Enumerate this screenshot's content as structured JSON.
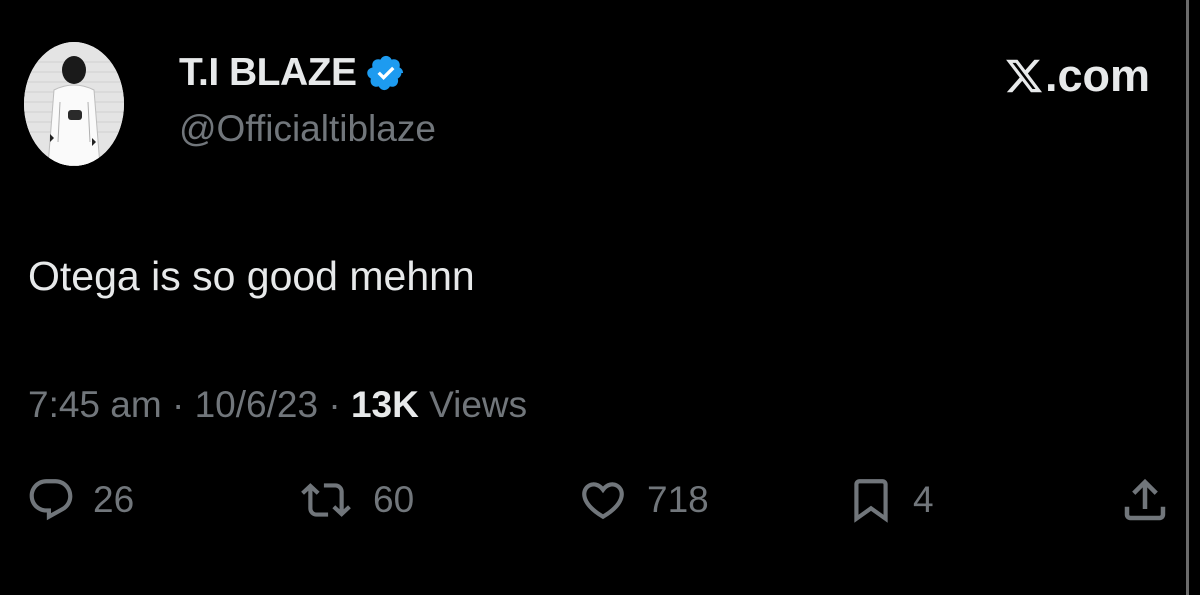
{
  "colors": {
    "background": "#000000",
    "text_primary": "#e7e9ea",
    "text_secondary": "#71767b",
    "verified_badge": "#1d9bf0"
  },
  "author": {
    "display_name": "T.I BLAZE",
    "handle": "@Officialtiblaze",
    "verified_icon": "verified-badge-icon",
    "avatar_icon": "profile-photo"
  },
  "brand": {
    "logo_icon": "x-logo-icon",
    "suffix": ".com"
  },
  "tweet": {
    "text": "Otega is so good mehnn"
  },
  "meta": {
    "time": "7:45 am",
    "separator": "·",
    "date": "10/6/23",
    "views_count": "13K",
    "views_label": "Views"
  },
  "actions": {
    "reply": {
      "icon": "reply-icon",
      "count": "26"
    },
    "retweet": {
      "icon": "retweet-icon",
      "count": "60"
    },
    "like": {
      "icon": "heart-icon",
      "count": "718"
    },
    "bookmark": {
      "icon": "bookmark-icon",
      "count": "4"
    },
    "share": {
      "icon": "share-icon"
    }
  }
}
